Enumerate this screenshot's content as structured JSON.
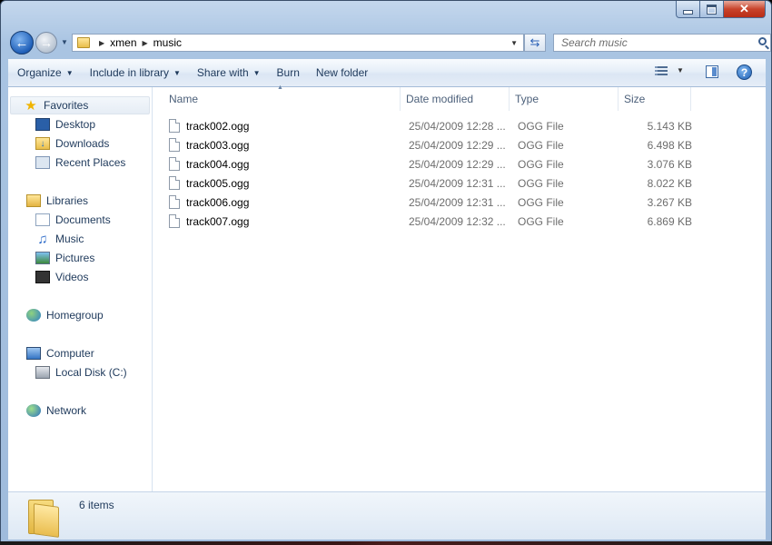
{
  "window": {
    "caption_buttons": {
      "minimize": "minimize-icon",
      "maximize": "maximize-icon",
      "close": "✕"
    }
  },
  "address": {
    "crumbs": [
      "xmen",
      "music"
    ],
    "search_placeholder": "Search music"
  },
  "toolbar": {
    "organize": "Organize",
    "include_in_library": "Include in library",
    "share_with": "Share with",
    "burn": "Burn",
    "new_folder": "New folder",
    "help": "?"
  },
  "nav": {
    "favorites": "Favorites",
    "desktop": "Desktop",
    "downloads": "Downloads",
    "recent_places": "Recent Places",
    "libraries": "Libraries",
    "documents": "Documents",
    "music": "Music",
    "pictures": "Pictures",
    "videos": "Videos",
    "homegroup": "Homegroup",
    "computer": "Computer",
    "local_disk": "Local Disk (C:)",
    "network": "Network"
  },
  "columns": {
    "name": "Name",
    "date_modified": "Date modified",
    "type": "Type",
    "size": "Size"
  },
  "files": [
    {
      "name": "track002.ogg",
      "date": "25/04/2009 12:28 ...",
      "type": "OGG File",
      "size": "5.143 KB"
    },
    {
      "name": "track003.ogg",
      "date": "25/04/2009 12:29 ...",
      "type": "OGG File",
      "size": "6.498 KB"
    },
    {
      "name": "track004.ogg",
      "date": "25/04/2009 12:29 ...",
      "type": "OGG File",
      "size": "3.076 KB"
    },
    {
      "name": "track005.ogg",
      "date": "25/04/2009 12:31 ...",
      "type": "OGG File",
      "size": "8.022 KB"
    },
    {
      "name": "track006.ogg",
      "date": "25/04/2009 12:31 ...",
      "type": "OGG File",
      "size": "3.267 KB"
    },
    {
      "name": "track007.ogg",
      "date": "25/04/2009 12:32 ...",
      "type": "OGG File",
      "size": "6.869 KB"
    }
  ],
  "status": {
    "item_count": "6 items"
  }
}
